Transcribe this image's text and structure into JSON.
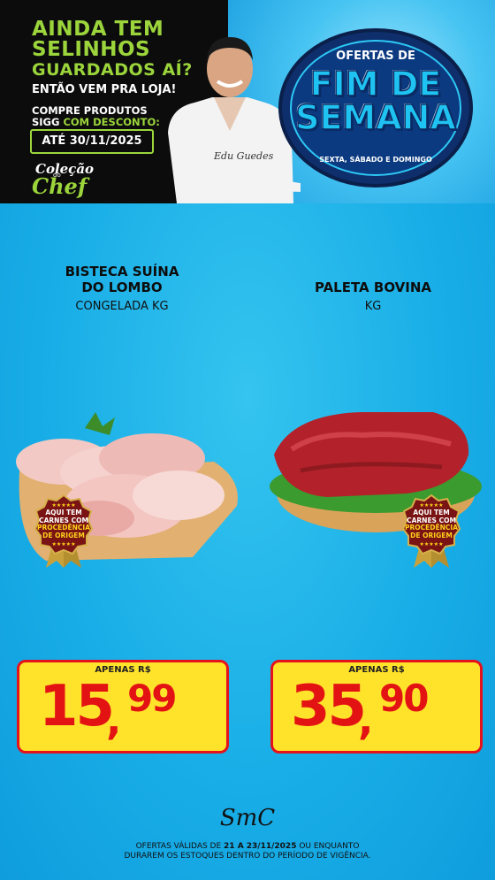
{
  "banner": {
    "headline_lines": [
      "AINDA TEM",
      "SELINHOS",
      "GUARDADOS AÍ?"
    ],
    "subheadline": "ENTÃO VEM PRA LOJA!",
    "compre_line1": "COMPRE PRODUTOS",
    "compre_line2_prefix": "SIGG",
    "compre_line2_highlight": "COM DESCONTO:",
    "date_label": "ATÉ 30/11/2025",
    "logo_colecao": "Coleção",
    "logo_do": "do",
    "logo_chef": "Chef",
    "offer_top": "OFERTAS DE",
    "offer_main_1": "FIM DE",
    "offer_main_2": "SEMANA",
    "offer_days": "SEXTA, SÁBADO E DOMINGO",
    "signature": "Edu Guedes"
  },
  "products": [
    {
      "name_line1": "BISTECA SUÍNA",
      "name_line2": "DO LOMBO",
      "unit": "CONGELADA KG",
      "price_label": "APENAS R$",
      "price_int": "15",
      "price_dec": "99"
    },
    {
      "name_line1": "PALETA BOVINA",
      "name_line2": "",
      "unit": "KG",
      "price_label": "APENAS R$",
      "price_int": "35",
      "price_dec": "90"
    }
  ],
  "seal": {
    "line1": "AQUI TEM",
    "line2": "CARNES COM",
    "line3": "PROCEDÊNCIA",
    "line4": "DE ORIGEM",
    "stars": "★★★★★"
  },
  "footer": {
    "logo": "SmC",
    "line1_prefix": "OFERTAS VÁLIDAS DE ",
    "line1_bold": "21 A 23/11/2025",
    "line1_suffix": " OU ENQUANTO",
    "line2": "DURAREM OS ESTOQUES DENTRO DO PERÍODO DE VIGÊNCIA."
  },
  "colors": {
    "background": "#19aee7",
    "accent_green": "#9bd53b",
    "price_yellow": "#ffe32a",
    "price_red": "#e31313"
  }
}
